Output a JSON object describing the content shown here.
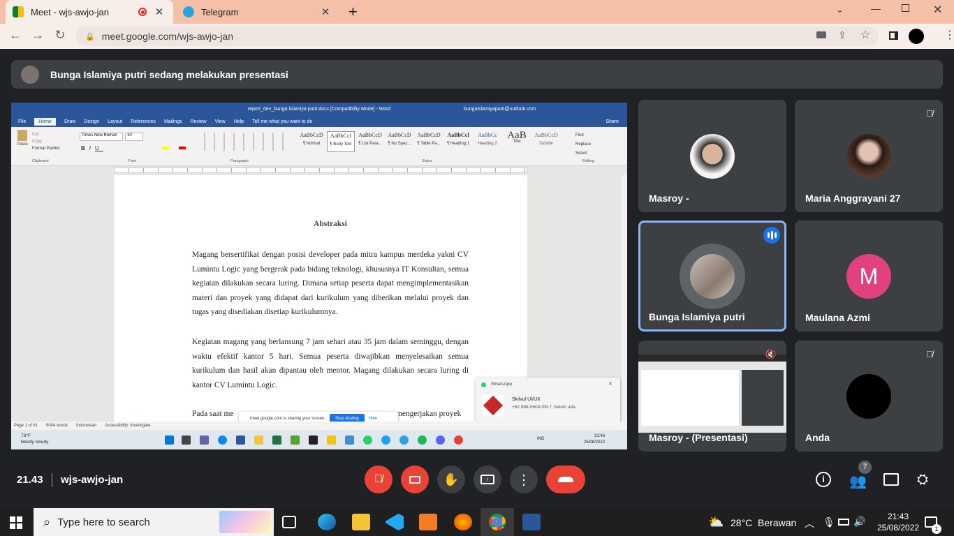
{
  "browser": {
    "tabs": [
      {
        "label": "Meet - wjs-awjo-jan",
        "active": true,
        "recording": true
      },
      {
        "label": "Telegram",
        "active": false
      }
    ],
    "url": "meet.google.com/wjs-awjo-jan",
    "new_tab_icon": "+"
  },
  "meet": {
    "presenting_banner": "Bunga Islamiya putri sedang melakukan presentasi",
    "time": "21.43",
    "meeting_code": "wjs-awjo-jan",
    "participant_count": "7",
    "participants": [
      {
        "name": "Masroy -",
        "muted": false
      },
      {
        "name": "Maria Anggrayani 27",
        "muted": true
      },
      {
        "name": "Bunga Islamiya putri",
        "muted": false,
        "speaking": true
      },
      {
        "name": "Maulana Azmi",
        "muted": false,
        "initial": "M",
        "color": "#e0427f"
      },
      {
        "name": "Masroy - (Presentasi)",
        "muted": true
      },
      {
        "name": "Anda",
        "muted": true
      }
    ]
  },
  "shared_screen": {
    "window_title": "report_dev_bunga islamiya putri.docx [Compatibility Mode]  -  Word",
    "account": "bungaislamiyaputri@outlook.com",
    "ribbon_tabs": [
      "File",
      "Home",
      "Draw",
      "Design",
      "Layout",
      "References",
      "Mailings",
      "Review",
      "View",
      "Help",
      "Tell me what you want to do"
    ],
    "share_label": "Share",
    "font_name": "Times New Roman",
    "font_size": "10",
    "styles": [
      {
        "preview": "AaBbCcD",
        "name": "¶ Normal"
      },
      {
        "preview": "AaBbCcI",
        "name": "¶ Body Text"
      },
      {
        "preview": "AaBbCcD",
        "name": "¶ List Para..."
      },
      {
        "preview": "AaBbCcD",
        "name": "¶ No Spac..."
      },
      {
        "preview": "AaBbCcD",
        "name": "¶ Table Pa..."
      },
      {
        "preview": "AaBbCcl",
        "name": "¶ Heading 1"
      },
      {
        "preview": "AaBbCc",
        "name": "Heading 2"
      },
      {
        "preview": "AaB",
        "name": "Title"
      },
      {
        "preview": "AaBbCcD",
        "name": "Subtitle"
      }
    ],
    "group_labels": [
      "Clipboard",
      "Font",
      "Paragraph",
      "Styles",
      "Editing"
    ],
    "clipboard": {
      "paste": "Paste",
      "cut": "Cut",
      "copy": "Copy",
      "format_painter": "Format Painter"
    },
    "editing": {
      "find": "Find",
      "replace": "Replace",
      "select": "Select"
    },
    "doc_heading": "Abstraksi",
    "paragraph1": "Magang bersertifikat dengan posisi developer pada mitra kampus merdeka yakni CV Lumintu Logic yang bergerak pada bidang teknologi, khususnya IT Konsultan, semua kegiatan dilakukan secara luring. Dimana setiap peserta dapat mengimplementasikan materi dan proyek yang didapat dari kurikulum yang diberikan melalui proyek dan tugas yang disediakan disetiap kurikulumnya.",
    "paragraph2": "Kegiatan magang yang berlansung 7 jam sehari atau 35 jam dalam seminggu, dengan waktu efektif kantor 5 hari. Semua peserta diwajibkan menyelesaikan semua kurikulum dan hasil akan dipantau oleh mentor. Magang dilakukan secara luring di kantor CV Lumintu Logic.",
    "paragraph3_start": "Pada saat me",
    "paragraph3_end": "mengerjakan proyek",
    "status": {
      "page": "Page 1 of 61",
      "words": "9004 words",
      "language": "Indonesian",
      "accessibility": "Accessibility: Investigate"
    },
    "sharing_notice": {
      "text": "meet.google.com is sharing your screen.",
      "stop": "Stop sharing",
      "hide": "Hide"
    },
    "whatsapp": {
      "app": "WhatsApp",
      "title": "Skilvul UI/UX",
      "body": "+62 888-0603-0917: belum ada"
    },
    "weather": {
      "temp": "73°F",
      "desc": "Mostly cloudy"
    },
    "tray": {
      "lang": "IND",
      "time": "21:46",
      "date": "25/08/2022"
    }
  },
  "windows": {
    "search_placeholder": "Type here to search",
    "weather": "28°C  Berawan",
    "time": "21:43",
    "date": "25/08/2022",
    "notif_count": "1"
  }
}
